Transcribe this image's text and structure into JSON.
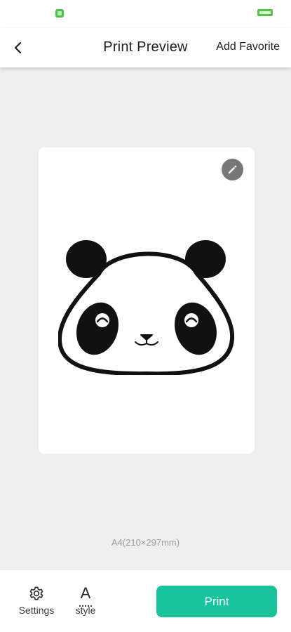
{
  "header": {
    "back_icon": "chevron-left-icon",
    "title": "Print Preview",
    "action_label": "Add Favorite"
  },
  "preview": {
    "edit_icon": "pencil-icon",
    "image_subject": "panda-face",
    "paper_size": "A4(210×297mm)"
  },
  "toolbar": {
    "settings_label": "Settings",
    "settings_icon": "gear-icon",
    "style_letter": "A",
    "style_label": "style",
    "print_label": "Print"
  },
  "colors": {
    "accent": "#17c49c",
    "background": "#efefef",
    "surface": "#ffffff",
    "edit_button": "#777777",
    "status_green": "#57c346"
  }
}
